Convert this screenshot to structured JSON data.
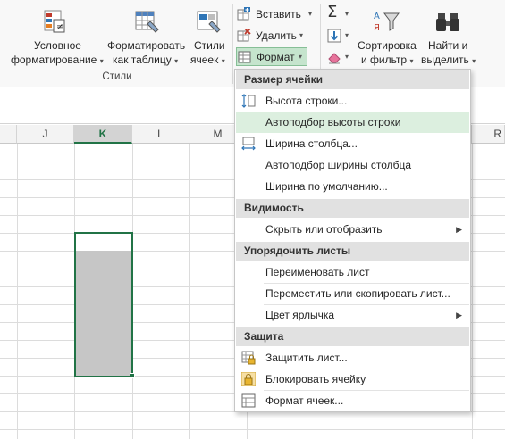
{
  "ribbon": {
    "conditional_formatting": {
      "line1": "Условное",
      "line2": "форматирование"
    },
    "format_as_table": {
      "line1": "Форматировать",
      "line2": "как таблицу"
    },
    "cell_styles": {
      "line1": "Стили",
      "line2": "ячеек"
    },
    "styles_group_label": "Стили",
    "cells": {
      "insert": "Вставить",
      "delete": "Удалить",
      "format": "Формат"
    },
    "sort_filter": {
      "line1": "Сортировка",
      "line2": "и фильтр"
    },
    "find_select": {
      "line1": "Найти и",
      "line2": "выделить"
    }
  },
  "grid": {
    "columns": [
      "J",
      "K",
      "L",
      "M"
    ],
    "right_partial_column": "R",
    "selected_column": "K"
  },
  "menu": {
    "sections": {
      "cell_size": "Размер ячейки",
      "visibility": "Видимость",
      "organize_sheets": "Упорядочить листы",
      "protection": "Защита"
    },
    "items": {
      "row_height": "Высота строки...",
      "autofit_row_height": "Автоподбор высоты строки",
      "column_width": "Ширина столбца...",
      "autofit_column_width": "Автоподбор ширины столбца",
      "default_width": "Ширина по умолчанию...",
      "hide_unhide": "Скрыть или отобразить",
      "rename_sheet": "Переименовать лист",
      "move_copy_sheet": "Переместить или скопировать лист...",
      "tab_color": "Цвет ярлычка",
      "protect_sheet": "Защитить лист...",
      "lock_cell": "Блокировать ячейку",
      "format_cells": "Формат ячеек..."
    }
  },
  "colors": {
    "accent_green": "#217346",
    "highlight": "#dcefdf",
    "selection_fill": "#c6c6c6"
  }
}
